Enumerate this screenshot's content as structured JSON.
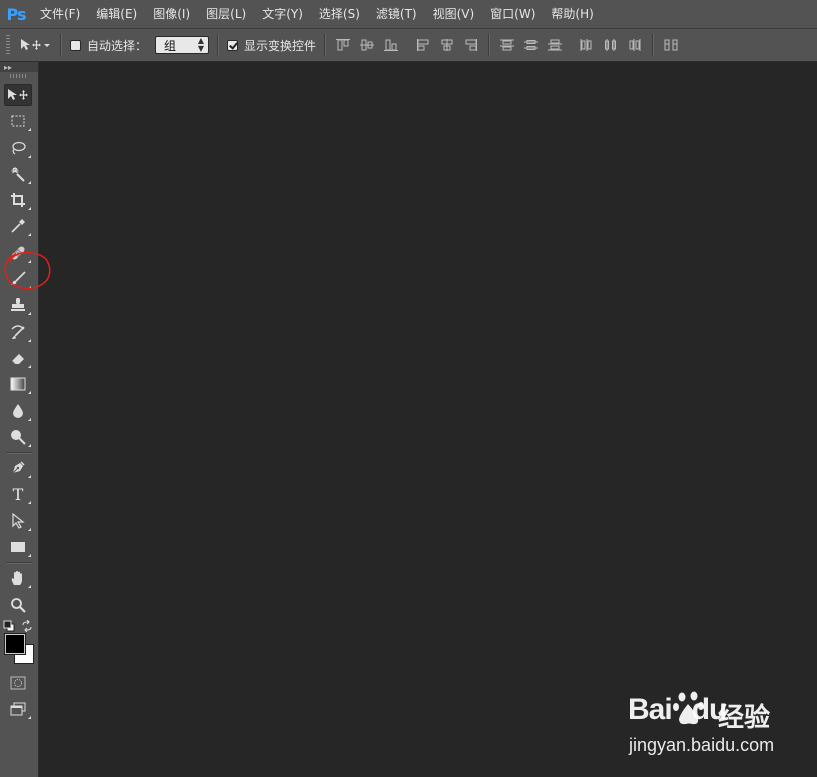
{
  "app": {
    "logo": "Ps"
  },
  "menu": [
    {
      "label": "文件(F)"
    },
    {
      "label": "编辑(E)"
    },
    {
      "label": "图像(I)"
    },
    {
      "label": "图层(L)"
    },
    {
      "label": "文字(Y)"
    },
    {
      "label": "选择(S)"
    },
    {
      "label": "滤镜(T)"
    },
    {
      "label": "视图(V)"
    },
    {
      "label": "窗口(W)"
    },
    {
      "label": "帮助(H)"
    }
  ],
  "options": {
    "auto_select_label": "自动选择：",
    "auto_select_checked": false,
    "auto_select_value": "组",
    "show_transform_label": "显示变换控件",
    "show_transform_checked": true
  },
  "tools": [
    {
      "name": "move-tool",
      "icon": "move-icon",
      "active": true
    },
    {
      "name": "marquee-tool",
      "icon": "rect-marquee-icon"
    },
    {
      "name": "lasso-tool",
      "icon": "lasso-icon"
    },
    {
      "name": "magic-wand-tool",
      "icon": "magic-wand-icon"
    },
    {
      "name": "crop-tool",
      "icon": "crop-icon"
    },
    {
      "name": "eyedropper-tool",
      "icon": "eyedropper-icon"
    },
    {
      "name": "spot-healing-tool",
      "icon": "bandage-icon",
      "highlighted": true
    },
    {
      "name": "brush-tool",
      "icon": "brush-icon"
    },
    {
      "name": "clone-stamp-tool",
      "icon": "stamp-icon"
    },
    {
      "name": "history-brush-tool",
      "icon": "history-brush-icon"
    },
    {
      "name": "eraser-tool",
      "icon": "eraser-icon"
    },
    {
      "name": "gradient-tool",
      "icon": "gradient-icon"
    },
    {
      "name": "blur-tool",
      "icon": "drop-icon"
    },
    {
      "name": "dodge-tool",
      "icon": "dodge-icon"
    },
    {
      "name": "pen-tool",
      "icon": "pen-icon"
    },
    {
      "name": "type-tool",
      "icon": "type-icon",
      "glyph": "T"
    },
    {
      "name": "path-selection-tool",
      "icon": "arrow-icon"
    },
    {
      "name": "rectangle-tool",
      "icon": "rectangle-icon"
    },
    {
      "name": "hand-tool",
      "icon": "hand-icon"
    },
    {
      "name": "zoom-tool",
      "icon": "zoom-icon"
    }
  ],
  "colors": {
    "foreground": "#000000",
    "background": "#ffffff",
    "annotation": "#e0201a",
    "ui": "#535353",
    "canvas": "#262626"
  },
  "watermark": {
    "brand": "Bai",
    "brand_tail": "du",
    "cn": "经验",
    "url": "jingyan.baidu.com"
  }
}
